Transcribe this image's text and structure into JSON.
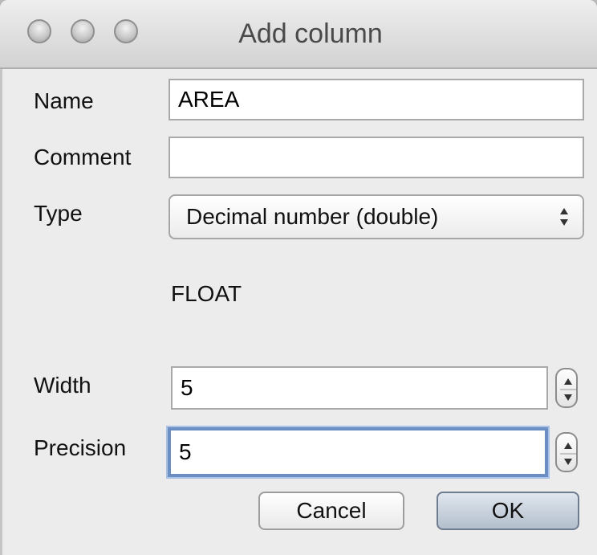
{
  "window": {
    "title": "Add column"
  },
  "form": {
    "name_label": "Name",
    "name_value": "AREA",
    "comment_label": "Comment",
    "comment_value": "",
    "type_label": "Type",
    "type_value": "Decimal number (double)",
    "type_info": "FLOAT",
    "width_label": "Width",
    "width_value": "5",
    "precision_label": "Precision",
    "precision_value": "5"
  },
  "buttons": {
    "cancel": "Cancel",
    "ok": "OK"
  },
  "icons": {
    "close": "close-icon",
    "minimize": "minimize-icon",
    "zoom": "zoom-icon",
    "select_arrows": "updown-arrows-icon",
    "stepper": "stepper-arrows-icon"
  },
  "colors": {
    "background": "#ececec",
    "focus_ring": "#6b8fc2",
    "default_button": "#b4bfcd"
  }
}
